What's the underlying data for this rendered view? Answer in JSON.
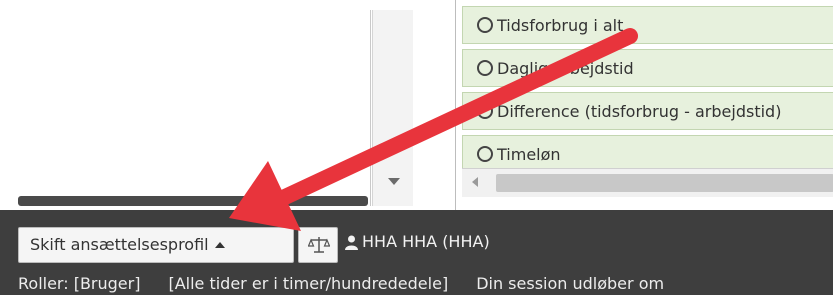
{
  "right_panel": {
    "rows": [
      {
        "label": "Tidsforbrug i alt"
      },
      {
        "label": "Daglig arbejdstid"
      },
      {
        "label": "Difference (tidsforbrug - arbejdstid)"
      },
      {
        "label": "Timeløn"
      }
    ]
  },
  "bottom_bar": {
    "profile_button_label": "Skift ansættelsesprofil",
    "user_label": "HHA HHA (HHA)",
    "roles": "Roller: [Bruger]",
    "times_note": "[Alle tider er i timer/hundrededele]",
    "session_text": "Din session udløber om"
  },
  "icons": {
    "profile_caret": "caret-up-icon",
    "scale_button": "scale-icon",
    "user": "user-icon",
    "radio": "radio-icon",
    "annotation": "arrow-icon"
  },
  "colors": {
    "bottom_bar": "#3e3e3e",
    "row_bg": "#e7f1dd",
    "annotation_arrow": "#e8343c"
  }
}
